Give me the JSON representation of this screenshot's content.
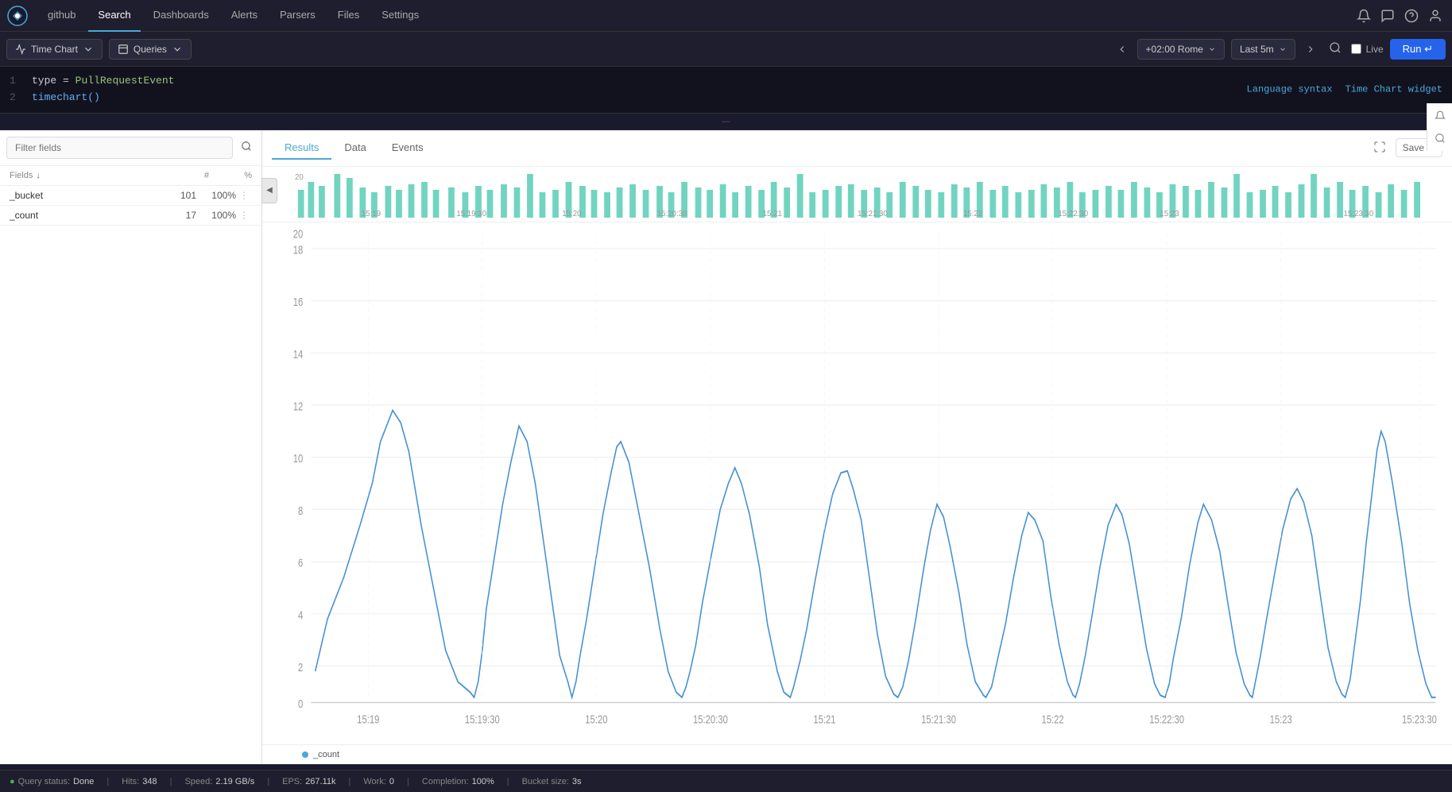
{
  "app": {
    "logo_alt": "Falcon logo"
  },
  "nav": {
    "items": [
      {
        "label": "github",
        "active": false
      },
      {
        "label": "Search",
        "active": true
      },
      {
        "label": "Dashboards",
        "active": false
      },
      {
        "label": "Alerts",
        "active": false
      },
      {
        "label": "Parsers",
        "active": false
      },
      {
        "label": "Files",
        "active": false
      },
      {
        "label": "Settings",
        "active": false
      }
    ]
  },
  "toolbar": {
    "chart_type_label": "Time Chart",
    "queries_label": "Queries",
    "timezone_label": "+02:00 Rome",
    "time_range_label": "Last 5m",
    "live_label": "Live",
    "run_label": "Run ↵"
  },
  "query": {
    "line1_num": "1",
    "line1_text": "type = PullRequestEvent",
    "line2_num": "2",
    "line2_func": "timechart()",
    "link_syntax": "Language syntax",
    "link_widget": "Time Chart widget",
    "divider_text": "—"
  },
  "sidebar": {
    "filter_placeholder": "Filter fields",
    "fields_header": "Fields",
    "fields_sort_icon": "↓",
    "fields_col_hash": "#",
    "fields_col_pct": "%",
    "fields": [
      {
        "name": "_bucket",
        "count": "101",
        "pct": "100%"
      },
      {
        "name": "_count",
        "count": "17",
        "pct": "100%"
      }
    ]
  },
  "chart": {
    "tabs": [
      {
        "label": "Results",
        "active": true
      },
      {
        "label": "Data",
        "active": false
      },
      {
        "label": "Events",
        "active": false
      }
    ],
    "save_label": "Save",
    "y_labels": [
      "0",
      "2",
      "4",
      "6",
      "8",
      "10",
      "12",
      "14",
      "16",
      "18",
      "20"
    ],
    "x_labels": [
      "15:19",
      "15:19:30",
      "15:20",
      "15:20:30",
      "15:21",
      "15:21:30",
      "15:22",
      "15:22:30",
      "15:23",
      "15:23:30"
    ],
    "legend_series": "_count",
    "legend_color": "#4aa8d8"
  },
  "status_bar": {
    "status_label": "Query status:",
    "status_value": "Done",
    "hits_label": "Hits:",
    "hits_value": "348",
    "speed_label": "Speed:",
    "speed_value": "2.19 GB/s",
    "eps_label": "EPS:",
    "eps_value": "267.11k",
    "work_label": "Work:",
    "work_value": "0",
    "completion_label": "Completion:",
    "completion_value": "100%",
    "bucket_label": "Bucket size:",
    "bucket_value": "3s"
  }
}
